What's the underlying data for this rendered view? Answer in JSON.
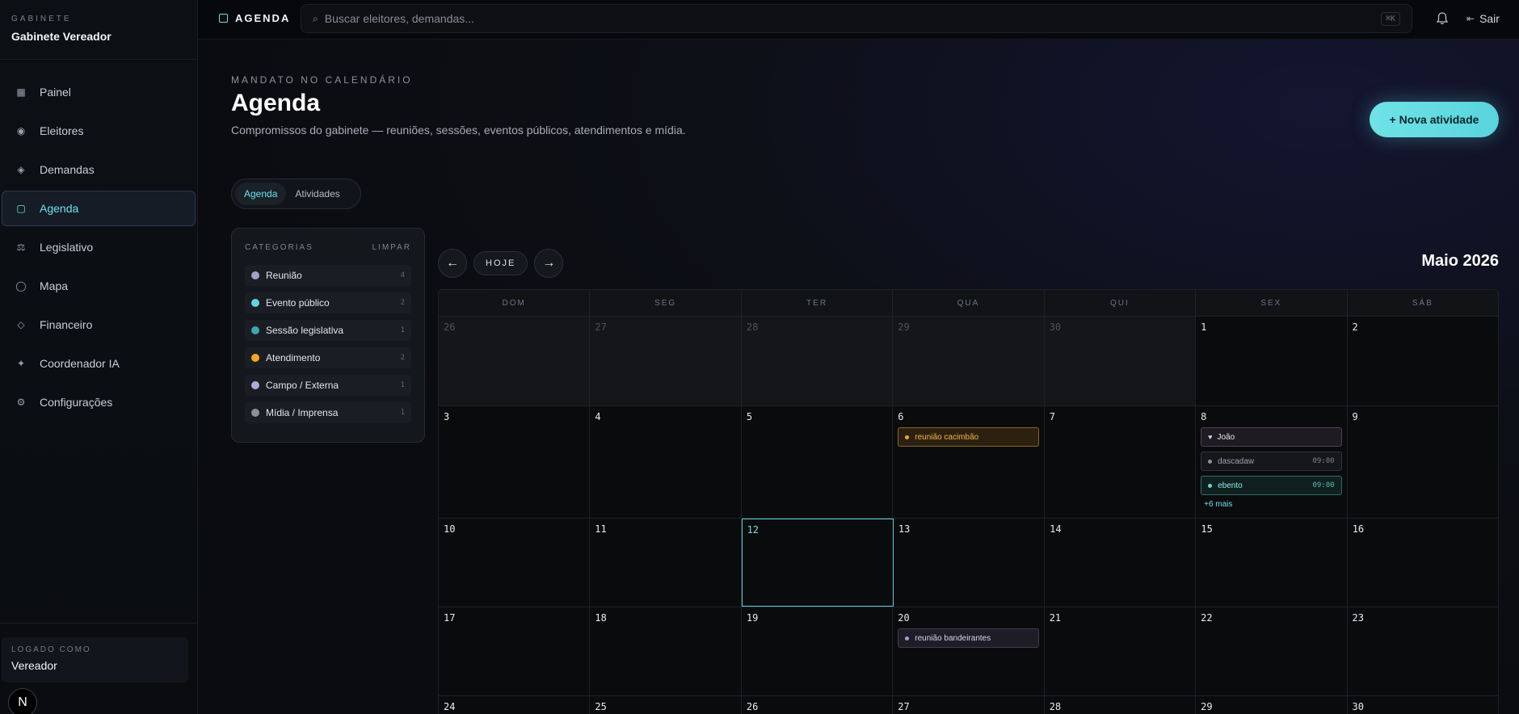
{
  "sidebar": {
    "kicker": "GABINETE",
    "name": "Gabinete Vereador",
    "items": [
      {
        "label": "Painel",
        "icon": "grid-icon"
      },
      {
        "label": "Eleitores",
        "icon": "target-icon"
      },
      {
        "label": "Demandas",
        "icon": "diamond-icon"
      },
      {
        "label": "Agenda",
        "icon": "square-icon",
        "active": true
      },
      {
        "label": "Legislativo",
        "icon": "scales-icon"
      },
      {
        "label": "Mapa",
        "icon": "circle-icon"
      },
      {
        "label": "Financeiro",
        "icon": "diamond-outline-icon"
      },
      {
        "label": "Coordenador IA",
        "icon": "sparkle-icon"
      },
      {
        "label": "Configurações",
        "icon": "gear-icon"
      }
    ],
    "logged_kicker": "LOGADO COMO",
    "logged_name": "Vereador",
    "badge": "N"
  },
  "topbar": {
    "title": "AGENDA",
    "search_placeholder": "Buscar eleitores, demandas...",
    "shortcut": "⌘K",
    "logout": "Sair"
  },
  "header": {
    "kicker": "MANDATO NO CALENDÁRIO",
    "title": "Agenda",
    "subtitle": "Compromissos do gabinete — reuniões, sessões, eventos públicos, atendimentos e mídia.",
    "new_button": "+ Nova atividade"
  },
  "tabs": [
    {
      "label": "Agenda",
      "active": true
    },
    {
      "label": "Atividades",
      "active": false
    }
  ],
  "categories": {
    "title": "CATEGORIAS",
    "clear": "LIMPAR",
    "items": [
      {
        "label": "Reunião",
        "count": "4",
        "color": "#a89fc4"
      },
      {
        "label": "Evento público",
        "count": "2",
        "color": "#5fd6dc"
      },
      {
        "label": "Sessão legislativa",
        "count": "1",
        "color": "#3fa7ad"
      },
      {
        "label": "Atendimento",
        "count": "2",
        "color": "#f2a623"
      },
      {
        "label": "Campo / Externa",
        "count": "1",
        "color": "#b3a8d6"
      },
      {
        "label": "Mídia / Imprensa",
        "count": "1",
        "color": "#8b909a"
      }
    ]
  },
  "calendar": {
    "today_label": "HOJE",
    "prev": "←",
    "next": "→",
    "month": "Maio 2026",
    "weekdays": [
      "DOM",
      "SEG",
      "TER",
      "QUA",
      "QUI",
      "SEX",
      "SÁB"
    ],
    "weeks": [
      [
        {
          "d": "26",
          "out": true
        },
        {
          "d": "27",
          "out": true
        },
        {
          "d": "28",
          "out": true
        },
        {
          "d": "29",
          "out": true
        },
        {
          "d": "30",
          "out": true
        },
        {
          "d": "1"
        },
        {
          "d": "2"
        }
      ],
      [
        {
          "d": "3"
        },
        {
          "d": "4"
        },
        {
          "d": "5"
        },
        {
          "d": "6",
          "events": [
            {
              "label": "reunião cacimbão",
              "style": "orange"
            }
          ]
        },
        {
          "d": "7"
        },
        {
          "d": "8",
          "events": [
            {
              "label": "João",
              "style": "heart"
            },
            {
              "label": "dascadaw",
              "time": "09:00",
              "style": "dark"
            },
            {
              "label": "ebento",
              "time": "09:00",
              "style": "cyan"
            }
          ],
          "more": "+6 mais"
        },
        {
          "d": "9"
        }
      ],
      [
        {
          "d": "10"
        },
        {
          "d": "11"
        },
        {
          "d": "12",
          "today": true
        },
        {
          "d": "13"
        },
        {
          "d": "14"
        },
        {
          "d": "15"
        },
        {
          "d": "16"
        }
      ],
      [
        {
          "d": "17"
        },
        {
          "d": "18"
        },
        {
          "d": "19"
        },
        {
          "d": "20",
          "events": [
            {
              "label": "reunião bandeirantes",
              "style": "purple"
            }
          ]
        },
        {
          "d": "21"
        },
        {
          "d": "22"
        },
        {
          "d": "23"
        }
      ],
      [
        {
          "d": "24"
        },
        {
          "d": "25"
        },
        {
          "d": "26"
        },
        {
          "d": "27"
        },
        {
          "d": "28"
        },
        {
          "d": "29"
        },
        {
          "d": "30"
        }
      ]
    ]
  }
}
